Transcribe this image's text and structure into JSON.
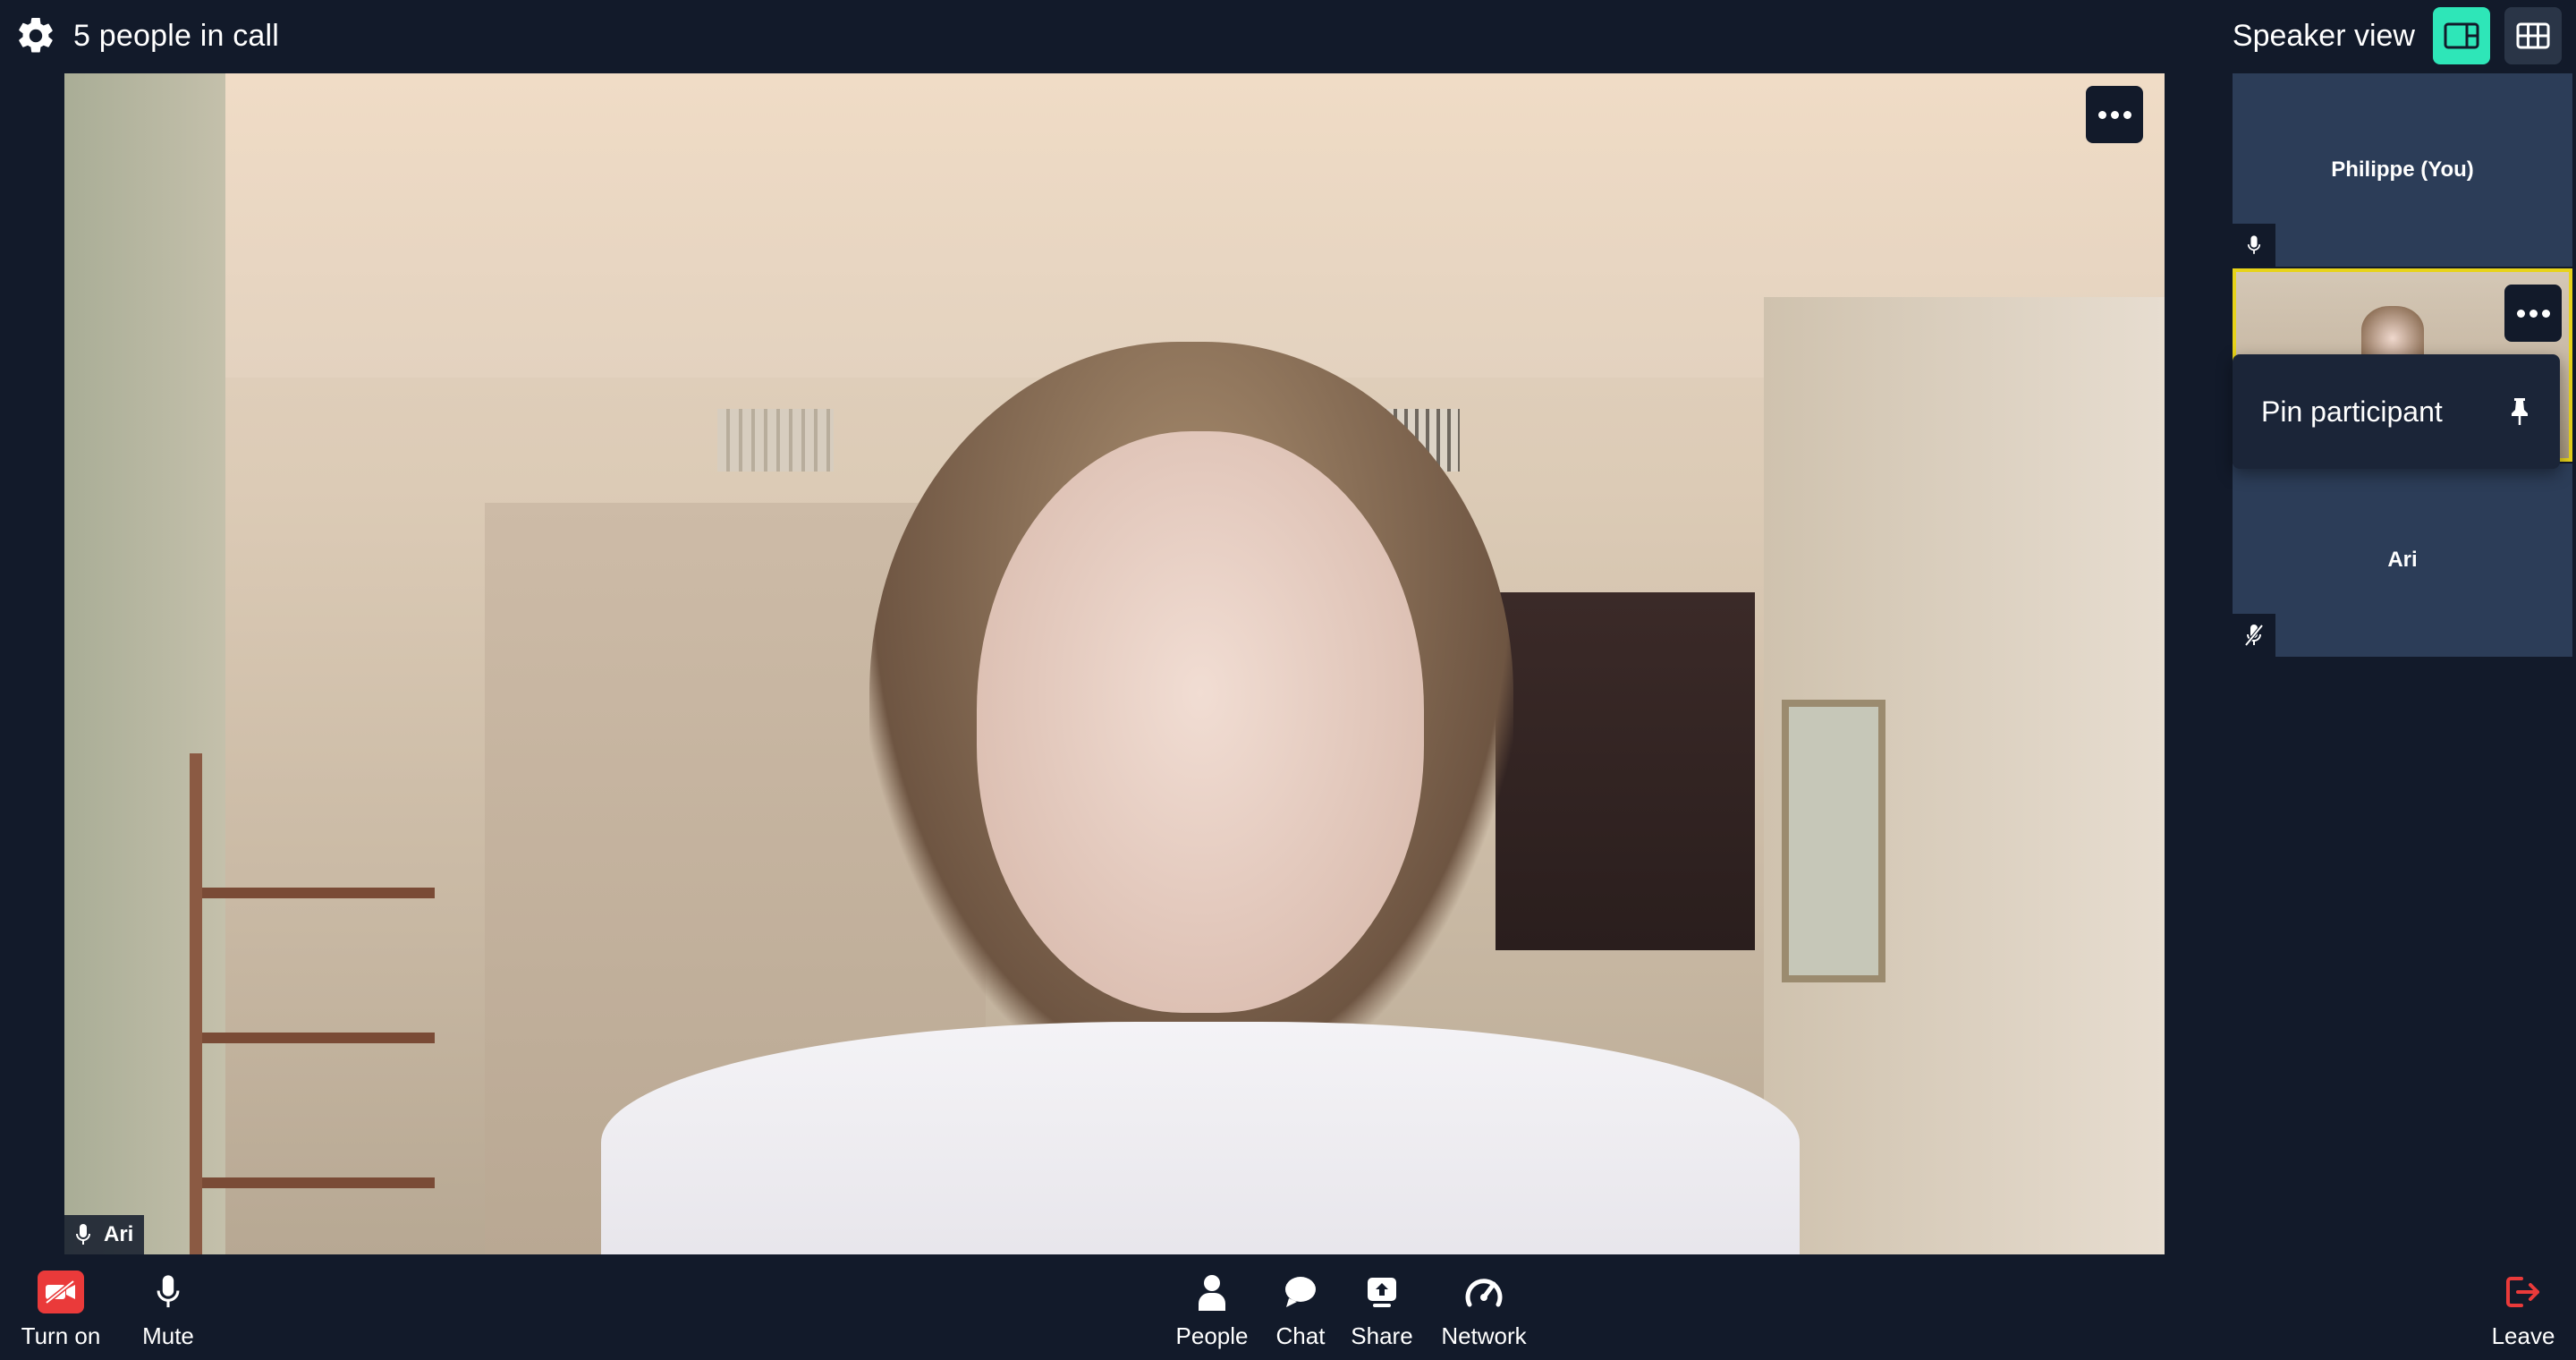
{
  "header": {
    "call_status": "5 people in call",
    "view_label": "Speaker view"
  },
  "main_video": {
    "participant_name": "Ari",
    "mic_state": "on"
  },
  "participants": [
    {
      "name": "Philippe (You)",
      "mic_state": "on",
      "video": "off"
    },
    {
      "name": "",
      "mic_state": "on",
      "video": "on",
      "highlighted": true
    },
    {
      "name": "Ari",
      "mic_state": "muted",
      "video": "off"
    }
  ],
  "tile_menu": {
    "pin_label": "Pin participant",
    "pin_icon": "pin-icon"
  },
  "toolbar": {
    "camera_label": "Turn on",
    "mic_label": "Mute",
    "people_label": "People",
    "chat_label": "Chat",
    "share_label": "Share",
    "network_label": "Network",
    "leave_label": "Leave"
  },
  "colors": {
    "background": "#121a2a",
    "tile": "#2c3d58",
    "accent": "#2ee6b8",
    "active_speaker_border": "#e7d31a",
    "danger": "#ea3a3a"
  }
}
